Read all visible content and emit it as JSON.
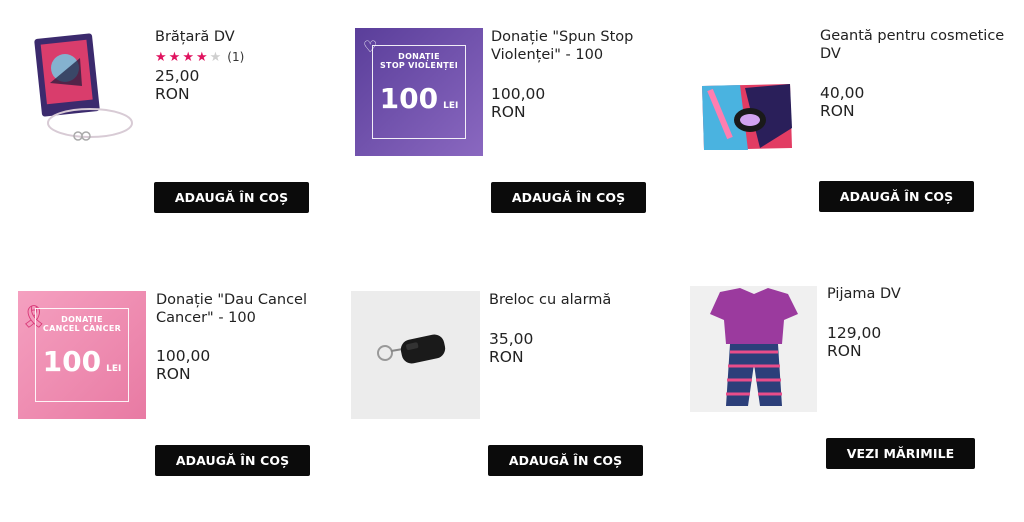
{
  "products": [
    {
      "title": "Brățară DV",
      "price": "25,00 RON",
      "button": "ADAUGĂ ÎN COȘ",
      "rating_count": "(1)",
      "rating_stars": 4,
      "rating_max": 5
    },
    {
      "title": "Donație \"Spun Stop Violenței\" - 100",
      "price": "100,00 RON",
      "button": "ADAUGĂ ÎN COȘ",
      "image_text": {
        "line1": "DONAȚIE",
        "line2": "STOP VIOLENȚEI",
        "amount": "100",
        "unit": "LEI"
      }
    },
    {
      "title": "Geantă pentru cosmetice DV",
      "price": "40,00 RON",
      "button": "ADAUGĂ ÎN COȘ"
    },
    {
      "title": "Donație \"Dau Cancel Cancer\" - 100",
      "price": "100,00 RON",
      "button": "ADAUGĂ ÎN COȘ",
      "image_text": {
        "line1": "DONAȚIE",
        "line2": "CANCEL CANCER",
        "amount": "100",
        "unit": "LEI"
      }
    },
    {
      "title": "Breloc cu alarmă",
      "price": "35,00 RON",
      "button": "ADAUGĂ ÎN COȘ"
    },
    {
      "title": "Pijama DV",
      "price": "129,00 RON",
      "button": "VEZI MĂRIMILE"
    }
  ],
  "colors": {
    "accent": "#e0135f",
    "button_bg": "#0b0b0b",
    "violet": "#7d5bb0",
    "pink": "#f08db1"
  }
}
